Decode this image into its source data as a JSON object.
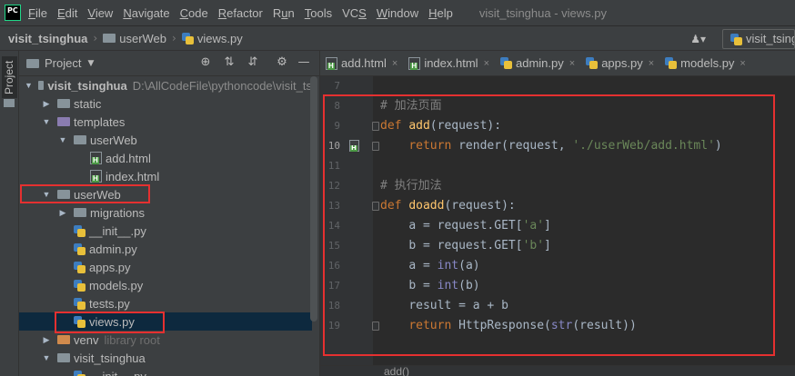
{
  "app": {
    "logo_text": "PC",
    "window_title": "visit_tsinghua - views.py"
  },
  "menu": [
    {
      "pre": "",
      "u": "F",
      "post": "ile"
    },
    {
      "pre": "",
      "u": "E",
      "post": "dit"
    },
    {
      "pre": "",
      "u": "V",
      "post": "iew"
    },
    {
      "pre": "",
      "u": "N",
      "post": "avigate"
    },
    {
      "pre": "",
      "u": "C",
      "post": "ode"
    },
    {
      "pre": "",
      "u": "R",
      "post": "efactor"
    },
    {
      "pre": "R",
      "u": "u",
      "post": "n"
    },
    {
      "pre": "",
      "u": "T",
      "post": "ools"
    },
    {
      "pre": "VC",
      "u": "S",
      "post": ""
    },
    {
      "pre": "",
      "u": "W",
      "post": "indow"
    },
    {
      "pre": "",
      "u": "H",
      "post": "elp"
    }
  ],
  "navbar": {
    "project": "visit_tsinghua",
    "folder": "userWeb",
    "file": "views.py",
    "user_icon": "user-icon",
    "run_config": "visit_tsing"
  },
  "toolwindow": {
    "label": "Project",
    "header_title": "Project"
  },
  "tree": [
    {
      "label": "visit_tsinghua",
      "path": "D:\\AllCodeFile\\pythoncode\\visit_ts",
      "depth": 0,
      "expanded": true,
      "icon": "folder-icon",
      "bold": true
    },
    {
      "label": "static",
      "depth": 1,
      "expanded": false,
      "icon": "folder-icon"
    },
    {
      "label": "templates",
      "depth": 1,
      "expanded": true,
      "icon": "folder-icon-purple"
    },
    {
      "label": "userWeb",
      "depth": 2,
      "expanded": true,
      "icon": "folder-icon"
    },
    {
      "label": "add.html",
      "depth": 3,
      "leaf": true,
      "icon": "html-icon"
    },
    {
      "label": "index.html",
      "depth": 3,
      "leaf": true,
      "icon": "html-icon"
    },
    {
      "label": "userWeb",
      "depth": 1,
      "expanded": true,
      "icon": "folder-icon"
    },
    {
      "label": "migrations",
      "depth": 2,
      "expanded": false,
      "icon": "folder-icon"
    },
    {
      "label": "__init__.py",
      "depth": 2,
      "leaf": true,
      "icon": "py-icon"
    },
    {
      "label": "admin.py",
      "depth": 2,
      "leaf": true,
      "icon": "py-icon"
    },
    {
      "label": "apps.py",
      "depth": 2,
      "leaf": true,
      "icon": "py-icon"
    },
    {
      "label": "models.py",
      "depth": 2,
      "leaf": true,
      "icon": "py-icon"
    },
    {
      "label": "tests.py",
      "depth": 2,
      "leaf": true,
      "icon": "py-icon"
    },
    {
      "label": "views.py",
      "depth": 2,
      "leaf": true,
      "icon": "py-icon",
      "selected": true
    },
    {
      "label": "venv",
      "extra": "library root",
      "depth": 1,
      "expanded": false,
      "icon": "folder-icon-excluded"
    },
    {
      "label": "visit_tsinghua",
      "depth": 1,
      "expanded": true,
      "icon": "folder-icon"
    },
    {
      "label": "__init__.py",
      "depth": 2,
      "leaf": true,
      "icon": "py-icon"
    }
  ],
  "tabs": [
    {
      "label": "add.html",
      "icon": "html-icon"
    },
    {
      "label": "index.html",
      "icon": "html-icon"
    },
    {
      "label": "admin.py",
      "icon": "py-icon"
    },
    {
      "label": "apps.py",
      "icon": "py-icon"
    },
    {
      "label": "models.py",
      "icon": "py-icon"
    }
  ],
  "code": {
    "first_line": 7,
    "current_line": 10,
    "lines": [
      {
        "n": "7",
        "t": ""
      },
      {
        "n": "8",
        "t": "# 加法页面"
      },
      {
        "n": "9",
        "t": "def add(request):"
      },
      {
        "n": "10",
        "t": "    return render(request, './userWeb/add.html')"
      },
      {
        "n": "11",
        "t": ""
      },
      {
        "n": "12",
        "t": "# 执行加法"
      },
      {
        "n": "13",
        "t": "def doadd(request):"
      },
      {
        "n": "14",
        "t": "    a = request.GET['a']"
      },
      {
        "n": "15",
        "t": "    b = request.GET['b']"
      },
      {
        "n": "16",
        "t": "    a = int(a)"
      },
      {
        "n": "17",
        "t": "    b = int(b)"
      },
      {
        "n": "18",
        "t": "    result = a + b"
      },
      {
        "n": "19",
        "t": "    return HttpResponse(str(result))"
      }
    ],
    "breadcrumb_bottom": "add()"
  },
  "colors": {
    "annotation": "#e53030",
    "selection": "#0d293e",
    "keyword": "#cc7832",
    "function": "#ffc66d",
    "string": "#6a8759",
    "comment": "#808080",
    "builtin": "#8888c6"
  }
}
